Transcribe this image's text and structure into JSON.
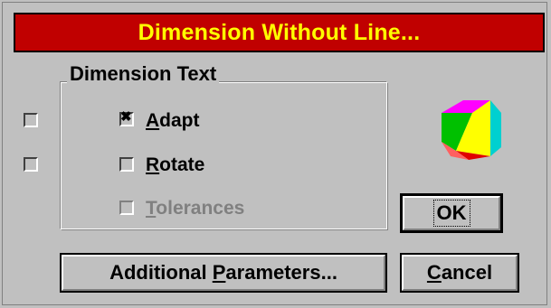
{
  "window": {
    "title": "Dimension Without Line..."
  },
  "group": {
    "legend": "Dimension Text"
  },
  "options": {
    "adapt": {
      "label_prefix": "",
      "mnemonic": "A",
      "label_rest": "dapt",
      "checked": true,
      "enabled": true
    },
    "rotate": {
      "label_prefix": "",
      "mnemonic": "R",
      "label_rest": "otate",
      "checked": false,
      "enabled": true
    },
    "tolerances": {
      "label_prefix": "",
      "mnemonic": "T",
      "label_rest": "olerances",
      "checked": false,
      "enabled": false
    }
  },
  "side_checkboxes": [
    {
      "checked": false
    },
    {
      "checked": false
    }
  ],
  "buttons": {
    "additional_prefix": "Additional ",
    "additional_mnemonic": "P",
    "additional_rest": "arameters...",
    "ok": "OK",
    "cancel_mnemonic": "C",
    "cancel_rest": "ancel"
  },
  "icon": {
    "name": "cube-icon"
  },
  "colors": {
    "title_bg": "#c00000",
    "title_text": "#ffff00",
    "dialog_bg": "#c0c0c0"
  }
}
